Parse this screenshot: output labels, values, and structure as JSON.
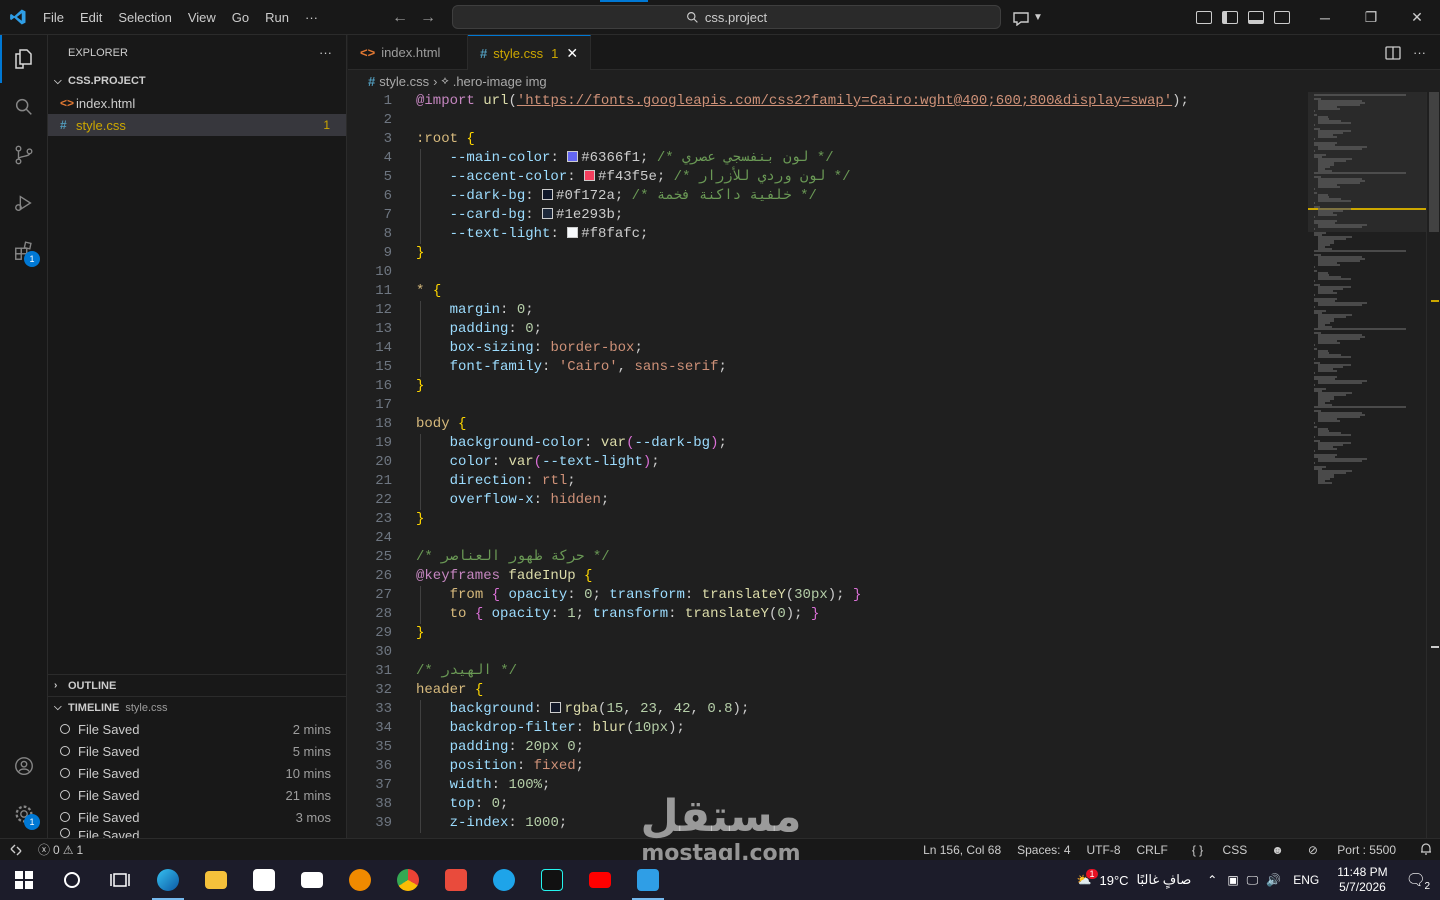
{
  "menu": [
    "File",
    "Edit",
    "Selection",
    "View",
    "Go",
    "Run",
    "···"
  ],
  "command_center": "css.project",
  "explorer": {
    "title": "EXPLORER",
    "more": "···",
    "project": "CSS.PROJECT",
    "files": [
      {
        "icon": "<>",
        "name": "index.html",
        "count": ""
      },
      {
        "icon": "#",
        "name": "style.css",
        "count": "1"
      }
    ]
  },
  "outline": {
    "title": "OUTLINE"
  },
  "timeline": {
    "title": "TIMELINE",
    "file": "style.css",
    "items": [
      {
        "label": "File Saved",
        "time": "2 mins"
      },
      {
        "label": "File Saved",
        "time": "5 mins"
      },
      {
        "label": "File Saved",
        "time": "10 mins"
      },
      {
        "label": "File Saved",
        "time": "21 mins"
      },
      {
        "label": "File Saved",
        "time": "3 mos"
      },
      {
        "label": "File Saved",
        "time": ""
      }
    ]
  },
  "tabs": [
    {
      "icon": "<>",
      "name": "index.html",
      "problems": ""
    },
    {
      "icon": "#",
      "name": "style.css",
      "problems": "1",
      "close": "✕"
    }
  ],
  "breadcrumb": {
    "file": "style.css",
    "symbol": ".hero-image img"
  },
  "colors": {
    "accent": "#0078d4",
    "warning": "#cca700"
  },
  "code_lines": [
    "@import url('https://fonts.googleapis.com/css2?family=Cairo:wght@400;600;800&display=swap');",
    "",
    ":root {",
    "    --main-color: #6366f1; /* لون بنفسجي عصري */",
    "    --accent-color: #f43f5e; /* لون وردي للأزرار */",
    "    --dark-bg: #0f172a; /* خلفية داكنة فخمة */",
    "    --card-bg: #1e293b;",
    "    --text-light: #f8fafc;",
    "}",
    "",
    "* {",
    "    margin: 0;",
    "    padding: 0;",
    "    box-sizing: border-box;",
    "    font-family: 'Cairo', sans-serif;",
    "}",
    "",
    "body {",
    "    background-color: var(--dark-bg);",
    "    color: var(--text-light);",
    "    direction: rtl;",
    "    overflow-x: hidden;",
    "}",
    "",
    "/* حركة ظهور العناصر */",
    "@keyframes fadeInUp {",
    "    from { opacity: 0; transform: translateY(30px); }",
    "    to { opacity: 1; transform: translateY(0); }",
    "}",
    "",
    "/* الهيدر */",
    "header {",
    "    background: rgba(15, 23, 42, 0.8);",
    "    backdrop-filter: blur(10px);",
    "    padding: 20px 0;",
    "    position: fixed;",
    "    width: 100%;",
    "    top: 0;",
    "    z-index: 1000;"
  ],
  "status": {
    "errors": "0",
    "warnings": "1",
    "position": "Ln 156, Col 68",
    "spaces": "Spaces: 4",
    "encoding": "UTF-8",
    "eol": "CRLF",
    "language": "CSS",
    "port": "Port : 5500"
  },
  "taskbar": {
    "weather_temp": "19°C",
    "weather_desc": "صافٍ غالبًا",
    "weather_badge": "1",
    "lang": "ENG",
    "time": "11:48 PM",
    "date": "5/7/2026",
    "notif_count": "2"
  },
  "watermark": {
    "ar": "مستقل",
    "en": "mostaql.com"
  }
}
